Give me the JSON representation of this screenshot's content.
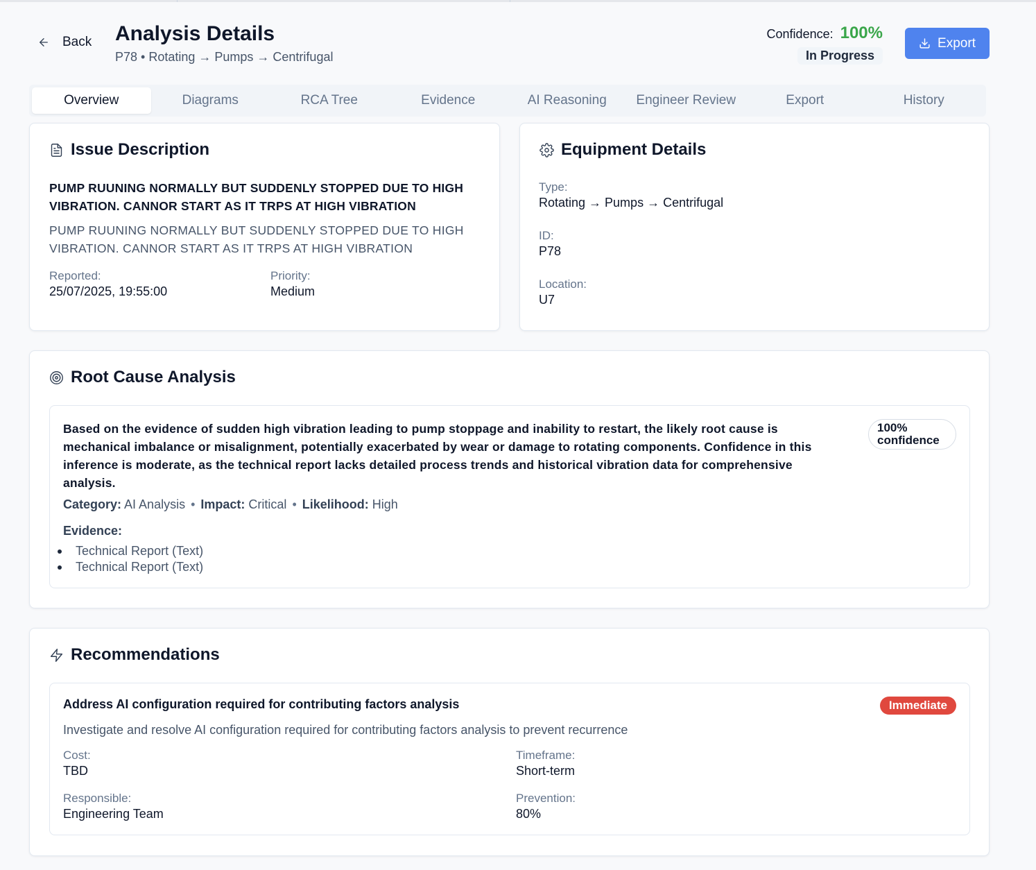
{
  "header": {
    "back_label": "Back",
    "title": "Analysis Details",
    "equipment_id": "P78",
    "equipment_path": "Rotating → Pumps → Centrifugal",
    "confidence_label": "Confidence:",
    "confidence_value": "100%",
    "status": "In Progress",
    "export_label": "Export",
    "colors": {
      "accent": "#4f83ee",
      "confidence": "#3aa64a"
    }
  },
  "tabs": [
    {
      "label": "Overview",
      "active": true
    },
    {
      "label": "Diagrams"
    },
    {
      "label": "RCA Tree"
    },
    {
      "label": "Evidence"
    },
    {
      "label": "AI Reasoning"
    },
    {
      "label": "Engineer Review"
    },
    {
      "label": "Export"
    },
    {
      "label": "History"
    }
  ],
  "issue": {
    "heading": "Issue Description",
    "summary": "PUMP RUUNING NORMALLY BUT SUDDENLY STOPPED DUE TO HIGH VIBRATION. CANNOR START AS IT TRPS AT HIGH VIBRATION",
    "description": "PUMP RUUNING NORMALLY BUT SUDDENLY STOPPED DUE TO HIGH VIBRATION. CANNOR START AS IT TRPS AT HIGH VIBRATION",
    "reported_label": "Reported:",
    "reported_value": "25/07/2025, 19:55:00",
    "priority_label": "Priority:",
    "priority_value": "Medium"
  },
  "equipment": {
    "heading": "Equipment Details",
    "type_label": "Type:",
    "type_value": "Rotating → Pumps → Centrifugal",
    "id_label": "ID:",
    "id_value": "P78",
    "location_label": "Location:",
    "location_value": "U7"
  },
  "rca": {
    "heading": "Root Cause Analysis",
    "text": "Based on the evidence of sudden high vibration leading to pump stoppage and inability to restart, the likely root cause is mechanical imbalance or misalignment, potentially exacerbated by wear or damage to rotating components. Confidence in this inference is moderate, as the technical report lacks detailed process trends and historical vibration data for comprehensive analysis.",
    "confidence_pill_value": "100%",
    "confidence_pill_word": "confidence",
    "category_label": "Category:",
    "category_value": "AI Analysis",
    "impact_label": "Impact:",
    "impact_value": "Critical",
    "likelihood_label": "Likelihood:",
    "likelihood_value": "High",
    "evidence_label": "Evidence:",
    "evidence": [
      "Technical Report (Text)",
      "Technical Report (Text)"
    ]
  },
  "recommendations": {
    "heading": "Recommendations",
    "items": [
      {
        "title": "Address AI configuration required for contributing factors analysis",
        "badge": "Immediate",
        "badge_color": "#e0483e",
        "description": "Investigate and resolve AI configuration required for contributing factors analysis to prevent recurrence",
        "cost_label": "Cost:",
        "cost_value": "TBD",
        "timeframe_label": "Timeframe:",
        "timeframe_value": "Short-term",
        "responsible_label": "Responsible:",
        "responsible_value": "Engineering Team",
        "prevention_label": "Prevention:",
        "prevention_value": "80%"
      }
    ]
  }
}
